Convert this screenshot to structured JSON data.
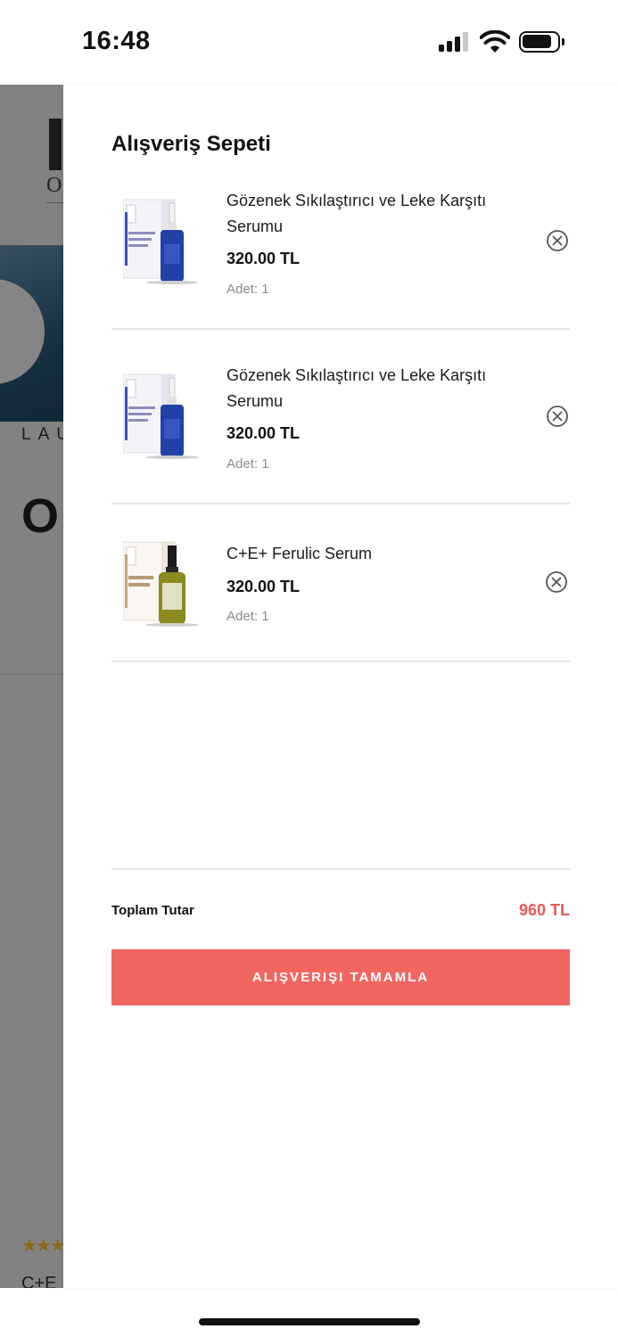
{
  "status_bar": {
    "time": "16:48"
  },
  "background_page": {
    "brand_subtitle": "LAU",
    "heading_fragment": "O",
    "product_name_fragment": "C+E"
  },
  "cart": {
    "title": "Alışveriş Sepeti",
    "items": [
      {
        "name": "Gözenek Sıkılaştırıcı ve Leke Karşıtı Serumu",
        "price": "320.00 TL",
        "quantity": "Adet: 1",
        "bottle_color": "#2140a8"
      },
      {
        "name": "Gözenek Sıkılaştırıcı ve Leke Karşıtı Serumu",
        "price": "320.00 TL",
        "quantity": "Adet: 1",
        "bottle_color": "#2140a8"
      },
      {
        "name": "C+E+ Ferulic Serum",
        "price": "320.00 TL",
        "quantity": "Adet: 1",
        "bottle_color": "#8a8a1e"
      }
    ],
    "total_label": "Toplam Tutar",
    "total_value": "960 TL",
    "checkout_label": "ALIŞVERIŞI TAMAMLA"
  },
  "colors": {
    "accent": "#f26662",
    "total_text": "#e85a58",
    "overlay": "#828282"
  }
}
